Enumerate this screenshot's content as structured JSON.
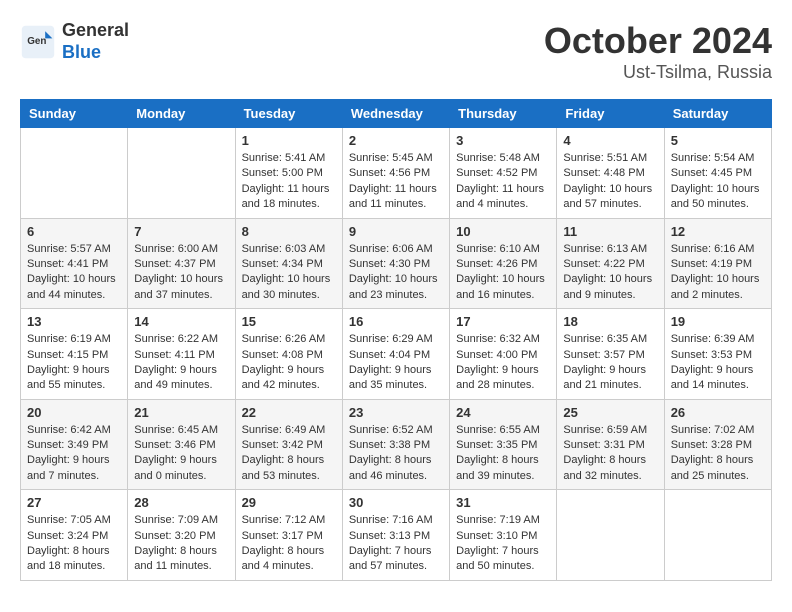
{
  "header": {
    "logo_general": "General",
    "logo_blue": "Blue",
    "month_title": "October 2024",
    "location": "Ust-Tsilma, Russia"
  },
  "days_of_week": [
    "Sunday",
    "Monday",
    "Tuesday",
    "Wednesday",
    "Thursday",
    "Friday",
    "Saturday"
  ],
  "weeks": [
    [
      {
        "day": "",
        "content": ""
      },
      {
        "day": "",
        "content": ""
      },
      {
        "day": "1",
        "content": "Sunrise: 5:41 AM\nSunset: 5:00 PM\nDaylight: 11 hours and 18 minutes."
      },
      {
        "day": "2",
        "content": "Sunrise: 5:45 AM\nSunset: 4:56 PM\nDaylight: 11 hours and 11 minutes."
      },
      {
        "day": "3",
        "content": "Sunrise: 5:48 AM\nSunset: 4:52 PM\nDaylight: 11 hours and 4 minutes."
      },
      {
        "day": "4",
        "content": "Sunrise: 5:51 AM\nSunset: 4:48 PM\nDaylight: 10 hours and 57 minutes."
      },
      {
        "day": "5",
        "content": "Sunrise: 5:54 AM\nSunset: 4:45 PM\nDaylight: 10 hours and 50 minutes."
      }
    ],
    [
      {
        "day": "6",
        "content": "Sunrise: 5:57 AM\nSunset: 4:41 PM\nDaylight: 10 hours and 44 minutes."
      },
      {
        "day": "7",
        "content": "Sunrise: 6:00 AM\nSunset: 4:37 PM\nDaylight: 10 hours and 37 minutes."
      },
      {
        "day": "8",
        "content": "Sunrise: 6:03 AM\nSunset: 4:34 PM\nDaylight: 10 hours and 30 minutes."
      },
      {
        "day": "9",
        "content": "Sunrise: 6:06 AM\nSunset: 4:30 PM\nDaylight: 10 hours and 23 minutes."
      },
      {
        "day": "10",
        "content": "Sunrise: 6:10 AM\nSunset: 4:26 PM\nDaylight: 10 hours and 16 minutes."
      },
      {
        "day": "11",
        "content": "Sunrise: 6:13 AM\nSunset: 4:22 PM\nDaylight: 10 hours and 9 minutes."
      },
      {
        "day": "12",
        "content": "Sunrise: 6:16 AM\nSunset: 4:19 PM\nDaylight: 10 hours and 2 minutes."
      }
    ],
    [
      {
        "day": "13",
        "content": "Sunrise: 6:19 AM\nSunset: 4:15 PM\nDaylight: 9 hours and 55 minutes."
      },
      {
        "day": "14",
        "content": "Sunrise: 6:22 AM\nSunset: 4:11 PM\nDaylight: 9 hours and 49 minutes."
      },
      {
        "day": "15",
        "content": "Sunrise: 6:26 AM\nSunset: 4:08 PM\nDaylight: 9 hours and 42 minutes."
      },
      {
        "day": "16",
        "content": "Sunrise: 6:29 AM\nSunset: 4:04 PM\nDaylight: 9 hours and 35 minutes."
      },
      {
        "day": "17",
        "content": "Sunrise: 6:32 AM\nSunset: 4:00 PM\nDaylight: 9 hours and 28 minutes."
      },
      {
        "day": "18",
        "content": "Sunrise: 6:35 AM\nSunset: 3:57 PM\nDaylight: 9 hours and 21 minutes."
      },
      {
        "day": "19",
        "content": "Sunrise: 6:39 AM\nSunset: 3:53 PM\nDaylight: 9 hours and 14 minutes."
      }
    ],
    [
      {
        "day": "20",
        "content": "Sunrise: 6:42 AM\nSunset: 3:49 PM\nDaylight: 9 hours and 7 minutes."
      },
      {
        "day": "21",
        "content": "Sunrise: 6:45 AM\nSunset: 3:46 PM\nDaylight: 9 hours and 0 minutes."
      },
      {
        "day": "22",
        "content": "Sunrise: 6:49 AM\nSunset: 3:42 PM\nDaylight: 8 hours and 53 minutes."
      },
      {
        "day": "23",
        "content": "Sunrise: 6:52 AM\nSunset: 3:38 PM\nDaylight: 8 hours and 46 minutes."
      },
      {
        "day": "24",
        "content": "Sunrise: 6:55 AM\nSunset: 3:35 PM\nDaylight: 8 hours and 39 minutes."
      },
      {
        "day": "25",
        "content": "Sunrise: 6:59 AM\nSunset: 3:31 PM\nDaylight: 8 hours and 32 minutes."
      },
      {
        "day": "26",
        "content": "Sunrise: 7:02 AM\nSunset: 3:28 PM\nDaylight: 8 hours and 25 minutes."
      }
    ],
    [
      {
        "day": "27",
        "content": "Sunrise: 7:05 AM\nSunset: 3:24 PM\nDaylight: 8 hours and 18 minutes."
      },
      {
        "day": "28",
        "content": "Sunrise: 7:09 AM\nSunset: 3:20 PM\nDaylight: 8 hours and 11 minutes."
      },
      {
        "day": "29",
        "content": "Sunrise: 7:12 AM\nSunset: 3:17 PM\nDaylight: 8 hours and 4 minutes."
      },
      {
        "day": "30",
        "content": "Sunrise: 7:16 AM\nSunset: 3:13 PM\nDaylight: 7 hours and 57 minutes."
      },
      {
        "day": "31",
        "content": "Sunrise: 7:19 AM\nSunset: 3:10 PM\nDaylight: 7 hours and 50 minutes."
      },
      {
        "day": "",
        "content": ""
      },
      {
        "day": "",
        "content": ""
      }
    ]
  ]
}
